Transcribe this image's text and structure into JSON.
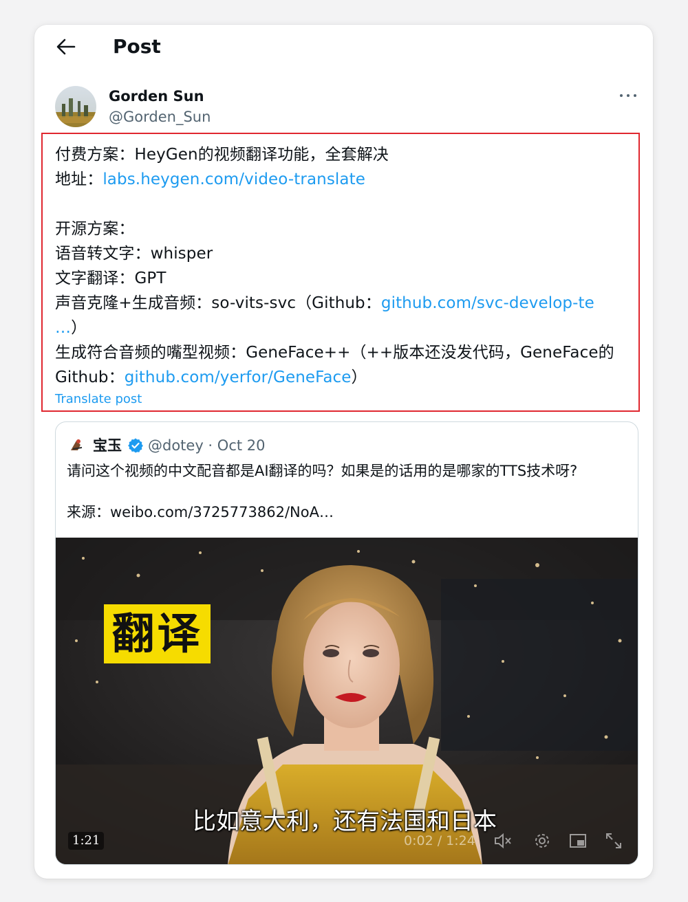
{
  "header": {
    "title": "Post"
  },
  "author": {
    "name": "Gorden Sun",
    "handle": "@Gorden_Sun"
  },
  "post": {
    "line1": "付费方案：HeyGen的视频翻译功能，全套解决",
    "line2_prefix": "地址：",
    "link1": "labs.heygen.com/video-translate",
    "line4": "开源方案：",
    "line5": "语音转文字：whisper",
    "line6": "文字翻译：GPT",
    "line7_prefix": "声音克隆+生成音频：so-vits-svc（Github：",
    "link2": "github.com/svc-develop-te\n…",
    "line7_suffix": "）",
    "line8": "生成符合音频的嘴型视频：GeneFace++（++版本还没发代码，GeneFace的Github：",
    "link3": "github.com/yerfor/GeneFace",
    "line8_suffix": "）",
    "translate_label": "Translate post"
  },
  "quote": {
    "name": "宝玉",
    "meta": "@dotey · Oct 20",
    "text": "请问这个视频的中文配音都是AI翻译的吗？如果是的话用的是哪家的TTS技术呀?",
    "source": "来源：weibo.com/3725773862/NoA…",
    "video": {
      "badge": "翻译",
      "subtitle": "比如意大利，还有法国和日本",
      "duration": "1:21",
      "time": "0:02 / 1:24"
    }
  },
  "icons": {
    "back": "arrow-left-icon",
    "more": "more-horizontal-icon",
    "verified": "verified-badge-icon",
    "mute": "speaker-muted-icon",
    "settings": "gear-icon",
    "dock": "picture-in-picture-icon",
    "fullscreen": "expand-icon"
  },
  "colors": {
    "accent": "#1d9bf0",
    "highlight_border": "#e0272f",
    "badge": "#f6dc00"
  }
}
